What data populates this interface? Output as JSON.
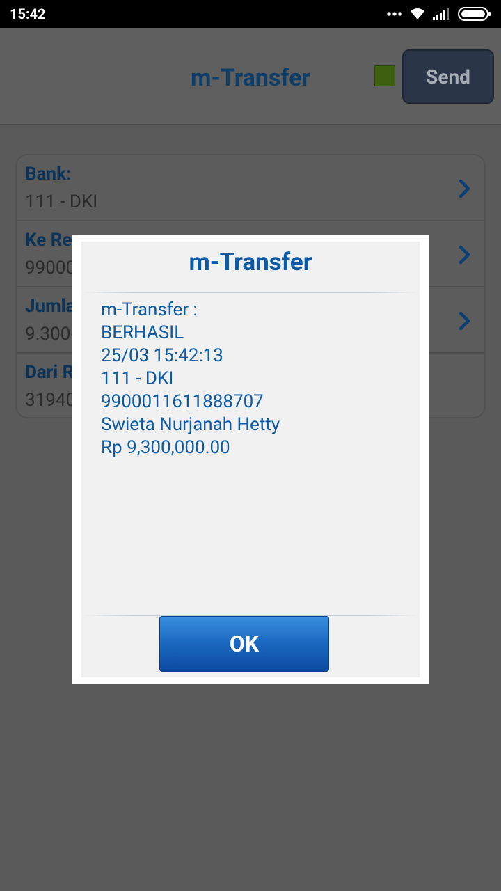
{
  "status_bar": {
    "time": "15:42",
    "icons": [
      "more-dots-icon",
      "wifi-icon",
      "signal-icon",
      "battery-icon"
    ]
  },
  "header": {
    "title": "m-Transfer",
    "send_label": "Send",
    "indicator_color": "#5ea81a"
  },
  "form": {
    "rows": [
      {
        "label": "Bank:",
        "value": "111 - DKI"
      },
      {
        "label": "Ke Re",
        "value": "99000"
      },
      {
        "label": "Jumla",
        "value": "9.300"
      },
      {
        "label": "Dari R",
        "value": "31940"
      }
    ]
  },
  "dialog": {
    "title": "m-Transfer",
    "lines": [
      "m-Transfer :",
      "BERHASIL",
      "25/03 15:42:13",
      "111 - DKI",
      "9900011611888707",
      "Swieta Nurjanah Hetty",
      "Rp 9,300,000.00"
    ],
    "ok_label": "OK"
  },
  "colors": {
    "accent_blue": "#0c5aa6",
    "overlay": "#5a5a5a"
  }
}
